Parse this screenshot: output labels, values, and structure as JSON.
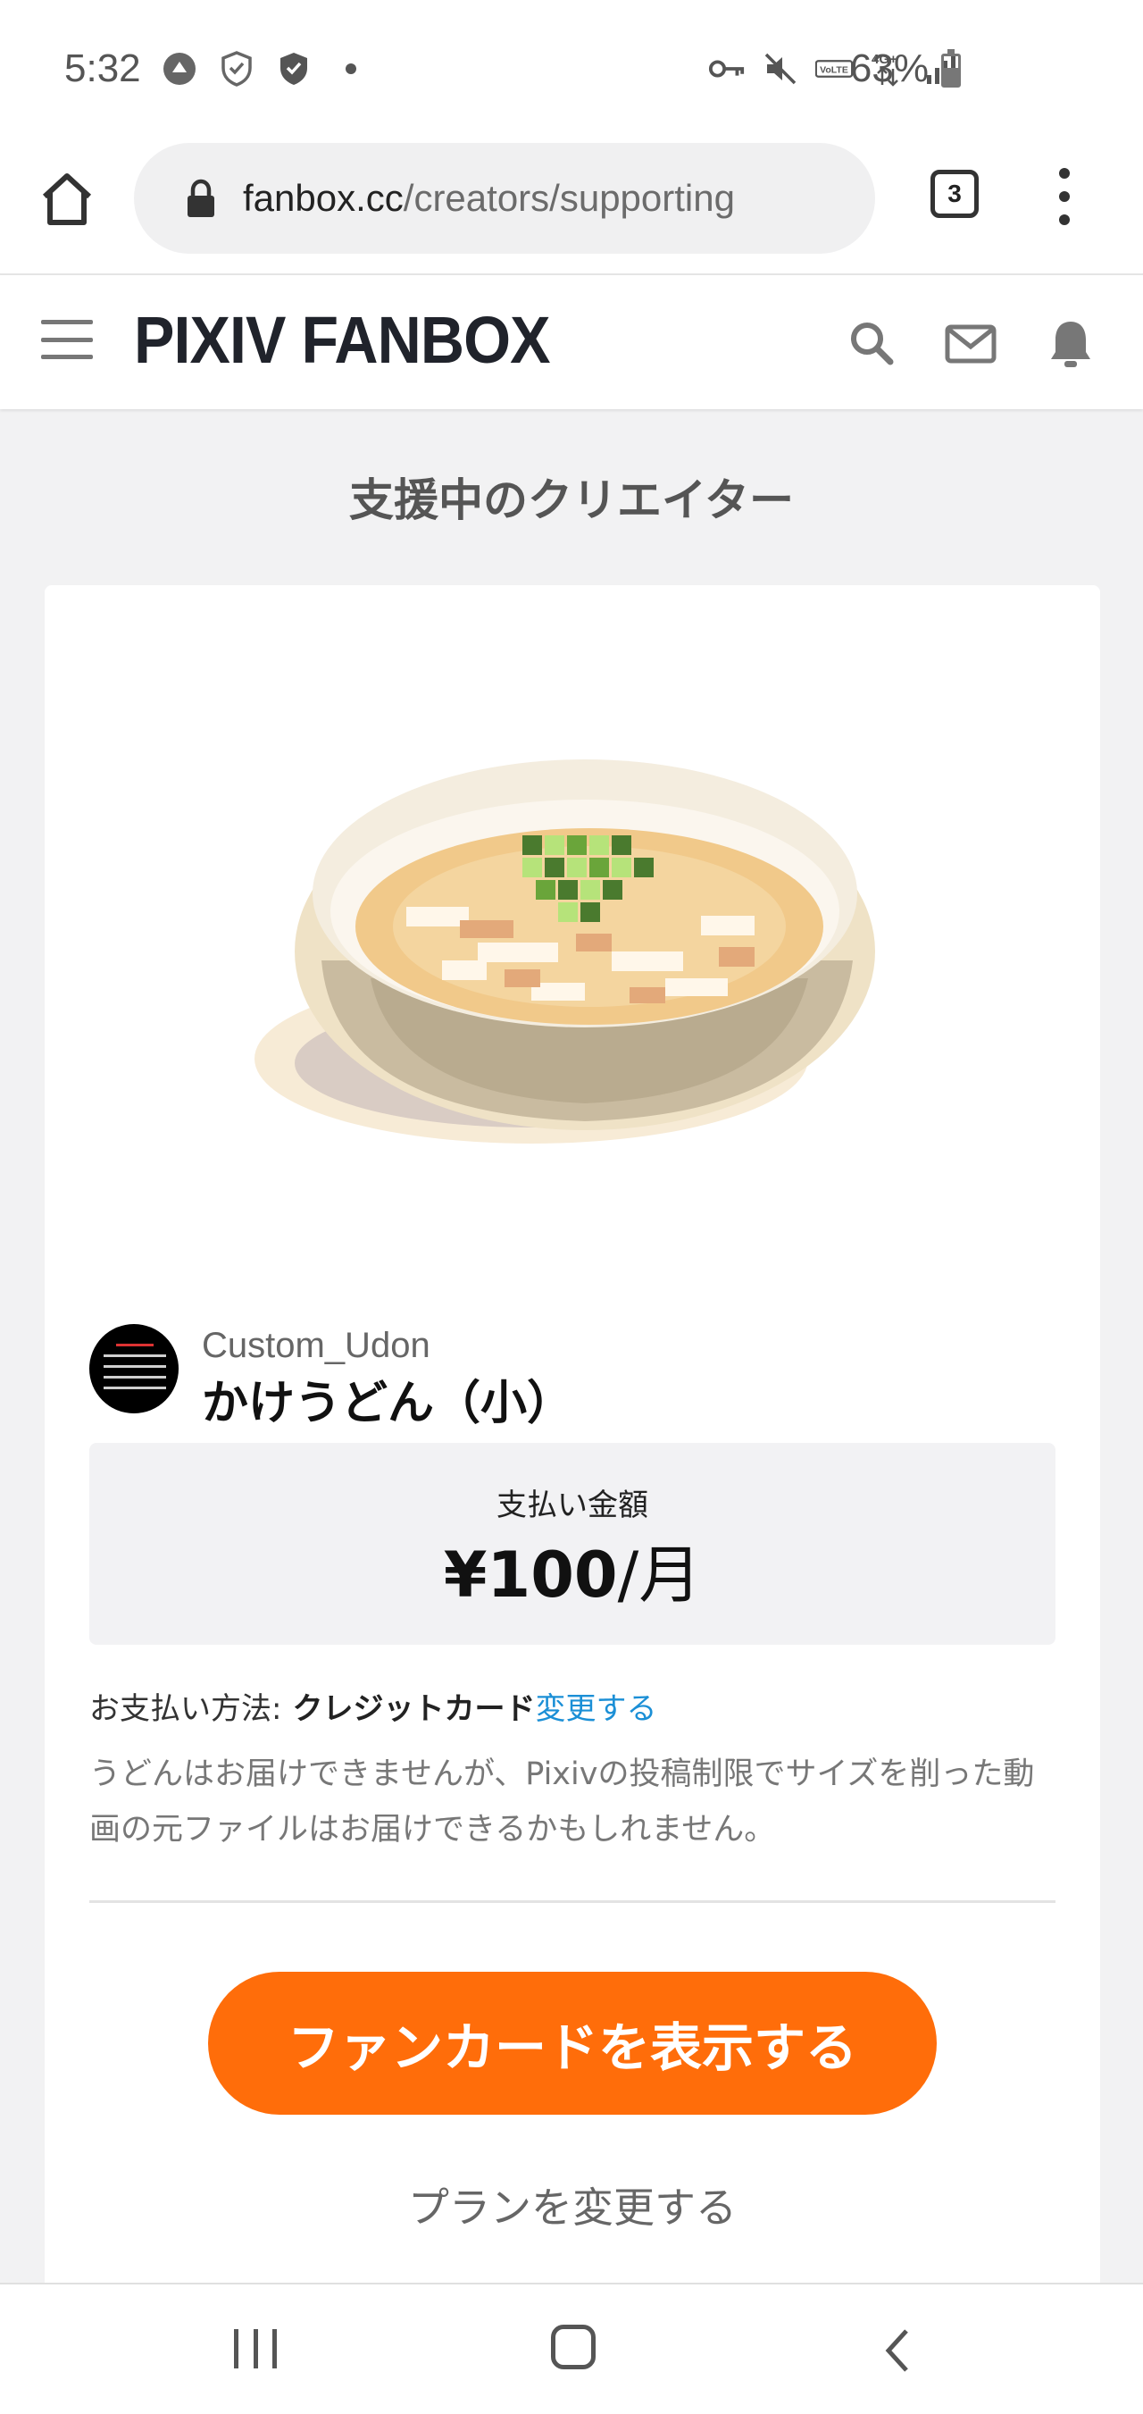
{
  "status_bar": {
    "time": "5:32",
    "battery": "63%"
  },
  "browser": {
    "url_domain": "fanbox.cc",
    "url_path": "/creators/supporting",
    "tab_count": "3"
  },
  "site": {
    "logo": "PIXIV FANBOX"
  },
  "page": {
    "title": "支援中のクリエイター"
  },
  "creator": {
    "name": "Custom_Udon",
    "plan_name": "かけうどん（小）"
  },
  "price": {
    "label": "支払い金額",
    "amount": "¥100",
    "unit": "/月"
  },
  "payment": {
    "label": "お支払い方法:",
    "method": "クレジットカード",
    "change_link": "変更する"
  },
  "description": "うどんはお届けできませんが、Pixivの投稿制限でサイズを削った動画の元ファイルはお届けできるかもしれません。",
  "actions": {
    "fancard_button": "ファンカードを表示する",
    "change_plan": "プランを変更する"
  },
  "colors": {
    "accent": "#ff6d0a",
    "link": "#1b8fd6"
  }
}
